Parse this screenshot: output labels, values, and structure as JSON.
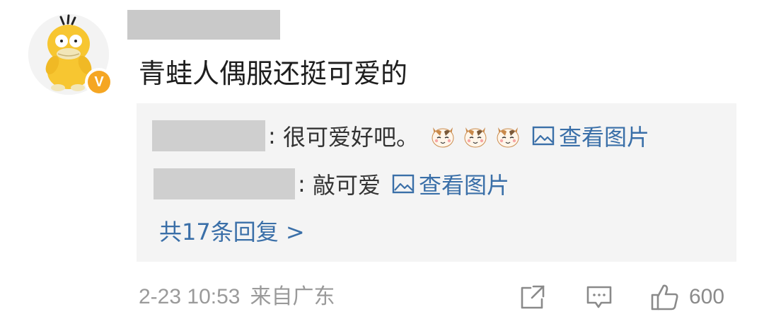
{
  "comment": {
    "text": "青蛙人偶服还挺可爱的"
  },
  "replies": [
    {
      "text": "很可爱好吧。",
      "emoji_count": 3,
      "emoji": "cat-face-emoji",
      "link_label": "查看图片"
    },
    {
      "text": "敲可爱",
      "link_label": "查看图片"
    }
  ],
  "more_replies": "共17条回复 >",
  "footer": {
    "date": "2-23 10:53",
    "location": "来自广东",
    "like_count": "600"
  },
  "colors": {
    "link": "#3a6fa8",
    "reply_bg": "#f4f4f4",
    "badge": "#f5a623",
    "meta": "#9a9a9a"
  },
  "icons": [
    "psyduck-avatar",
    "verified-badge-icon",
    "image-icon",
    "share-icon",
    "reply-icon",
    "like-icon"
  ]
}
